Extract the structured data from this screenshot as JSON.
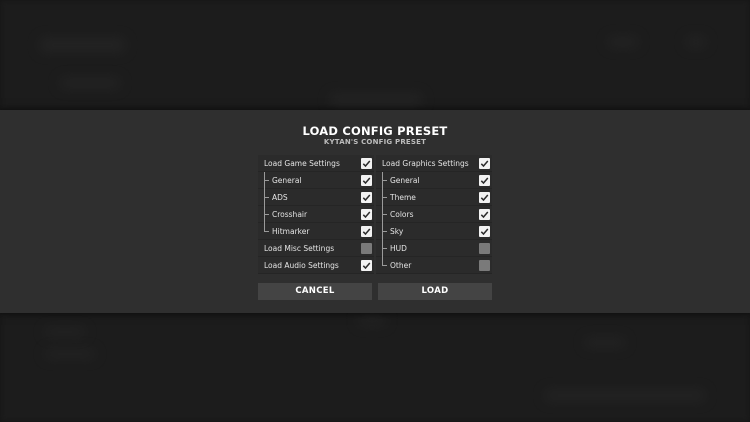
{
  "dialog": {
    "title": "LOAD CONFIG PRESET",
    "subtitle": "KYTAN'S CONFIG PRESET"
  },
  "left_column": [
    {
      "label": "Load Game Settings",
      "checked": true,
      "level": 0
    },
    {
      "label": "General",
      "checked": true,
      "level": 1
    },
    {
      "label": "ADS",
      "checked": true,
      "level": 1
    },
    {
      "label": "Crosshair",
      "checked": true,
      "level": 1
    },
    {
      "label": "Hitmarker",
      "checked": true,
      "level": 1
    },
    {
      "label": "Load Misc Settings",
      "checked": false,
      "level": 0
    },
    {
      "label": "Load Audio Settings",
      "checked": true,
      "level": 0
    }
  ],
  "right_column": [
    {
      "label": "Load Graphics Settings",
      "checked": true,
      "level": 0
    },
    {
      "label": "General",
      "checked": true,
      "level": 1
    },
    {
      "label": "Theme",
      "checked": true,
      "level": 1
    },
    {
      "label": "Colors",
      "checked": true,
      "level": 1
    },
    {
      "label": "Sky",
      "checked": true,
      "level": 1
    },
    {
      "label": "HUD",
      "checked": false,
      "level": 1
    },
    {
      "label": "Other",
      "checked": false,
      "level": 1
    }
  ],
  "buttons": {
    "cancel_label": "CANCEL",
    "load_label": "LOAD"
  },
  "colors": {
    "modal_band": "#2f2f2f",
    "row_bg": "#2b2b2b",
    "checkbox_checked": "#f2f2f2",
    "checkbox_unchecked": "#7a7a7a",
    "button_bg": "#444444",
    "backdrop": "#151515"
  },
  "icons": {
    "checked": "check-icon",
    "tree": "tree-connector-icon"
  }
}
